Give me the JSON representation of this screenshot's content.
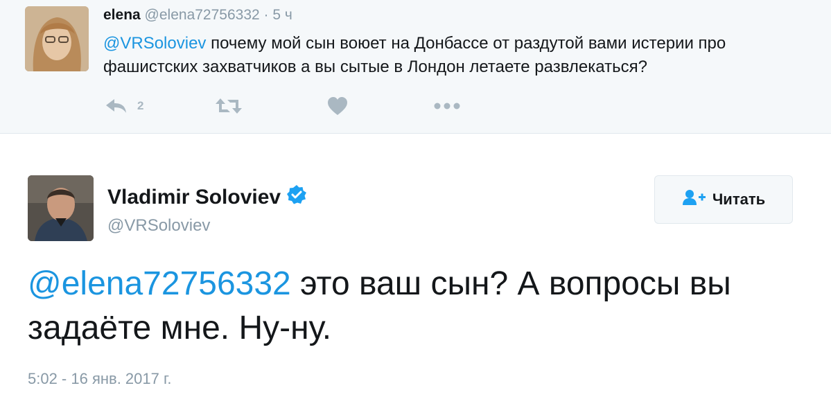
{
  "parent_tweet": {
    "name": "elena",
    "handle": "@elena72756332",
    "separator": "·",
    "time": "5 ч",
    "mention": "@VRSoloviev",
    "text": " почему мой сын воюет на Донбассе от раздутой вами истерии про фашистских захватчиков а вы сытые в Лондон летаете развлекаться?",
    "reply_count": "2",
    "icons": [
      "reply-icon",
      "retweet-icon",
      "heart-icon",
      "more-icon"
    ]
  },
  "main_tweet": {
    "name": "Vladimir Soloviev",
    "handle": "@VRSoloviev",
    "follow_label": "Читать",
    "mention": "@elena72756332",
    "text": " это ваш сын? А вопросы вы задаёте мне. Ну-ну.",
    "timestamp": "5:02 - 16 янв. 2017 г.",
    "icons": [
      "verified-badge-icon",
      "follow-user-icon"
    ]
  },
  "colors": {
    "link": "#1b95e0",
    "muted": "#8899a6",
    "icon": "#aab8c2",
    "parent_bg": "#f5f8fa",
    "verified": "#1da1f2"
  }
}
